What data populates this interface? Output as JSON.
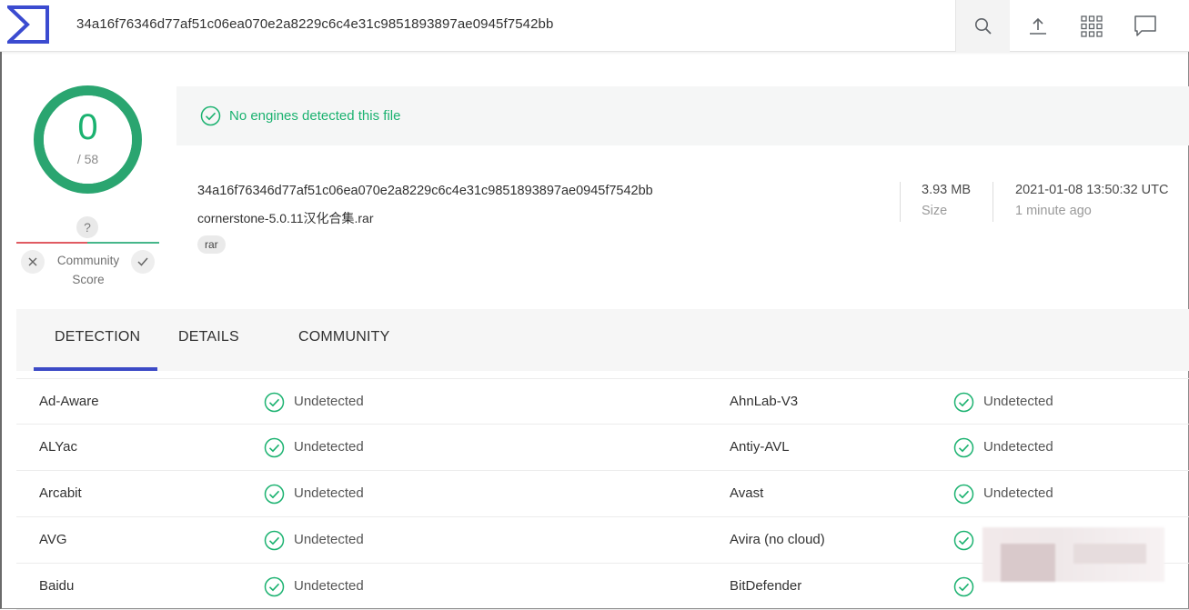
{
  "header": {
    "search_value": "34a16f76346d77af51c06ea070e2a8229c6c4e31c9851893897ae0945f7542bb",
    "icons": [
      "logo-icon",
      "search-icon",
      "upload-icon",
      "grid-menu-icon",
      "chat-icon"
    ]
  },
  "score": {
    "detections": "0",
    "total": "/ 58",
    "unknown_badge": "?",
    "community_label_line1": "Community",
    "community_label_line2": "Score"
  },
  "banner": {
    "text": "No engines detected this file"
  },
  "file": {
    "hash": "34a16f76346d77af51c06ea070e2a8229c6c4e31c9851893897ae0945f7542bb",
    "name": "cornerstone-5.0.11汉化合集.rar",
    "tag": "rar",
    "size_value": "3.93 MB",
    "size_label": "Size",
    "date_value": "2021-01-08 13:50:32 UTC",
    "date_label": "1 minute ago"
  },
  "tabs": [
    {
      "label": "DETECTION",
      "active": true
    },
    {
      "label": "DETAILS",
      "active": false
    },
    {
      "label": "COMMUNITY",
      "active": false
    }
  ],
  "detections": [
    {
      "left_engine": "Ad-Aware",
      "left_result": "Undetected",
      "right_engine": "AhnLab-V3",
      "right_result": "Undetected"
    },
    {
      "left_engine": "ALYac",
      "left_result": "Undetected",
      "right_engine": "Antiy-AVL",
      "right_result": "Undetected"
    },
    {
      "left_engine": "Arcabit",
      "left_result": "Undetected",
      "right_engine": "Avast",
      "right_result": "Undetected"
    },
    {
      "left_engine": "AVG",
      "left_result": "Undetected",
      "right_engine": "Avira (no cloud)",
      "right_result": ""
    },
    {
      "left_engine": "Baidu",
      "left_result": "Undetected",
      "right_engine": "BitDefender",
      "right_result": ""
    }
  ],
  "colors": {
    "clean_green": "#1bb270",
    "accent_blue": "#3c4ac6",
    "negative_red": "#e05b62"
  }
}
